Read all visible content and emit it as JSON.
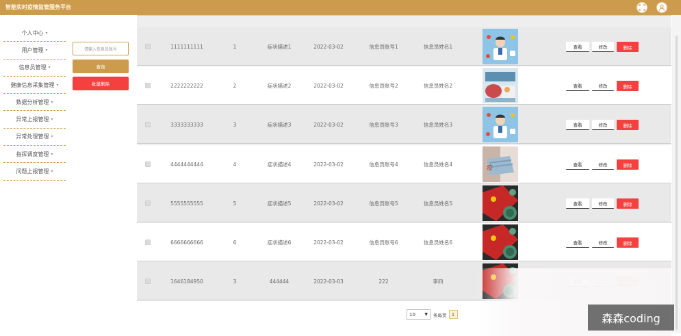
{
  "app": {
    "title": "智能实时疫情监管服务平台"
  },
  "topbar_icons": [
    "fullscreen-icon",
    "user-icon"
  ],
  "sidebar": {
    "items": [
      {
        "label": "个人中心"
      },
      {
        "label": "用户管理"
      },
      {
        "label": "信息员管理"
      },
      {
        "label": "健康信息采集管理"
      },
      {
        "label": "数据分析管理"
      },
      {
        "label": "异常上报管理"
      },
      {
        "label": "异常处理管理"
      },
      {
        "label": "指挥调度管理"
      },
      {
        "label": "问题上报管理"
      }
    ],
    "chevron": "▾"
  },
  "search": {
    "placeholder": "请输入信息员账号",
    "query_label": "查询",
    "batch_delete_label": "批量删除"
  },
  "table": {
    "rows": [
      {
        "account": "1111111111",
        "count": "1",
        "symptom": "症状描述1",
        "date": "2022-03-02",
        "informant_account": "信息员账号1",
        "informant_name": "信息员姓名1",
        "image": "doctor"
      },
      {
        "account": "2222222222",
        "count": "2",
        "symptom": "症状描述2",
        "date": "2022-03-02",
        "informant_account": "信息员账号2",
        "informant_name": "信息员姓名2",
        "image": "lab"
      },
      {
        "account": "3333333333",
        "count": "3",
        "symptom": "症状描述3",
        "date": "2022-03-02",
        "informant_account": "信息员账号3",
        "informant_name": "信息员姓名3",
        "image": "doctor"
      },
      {
        "account": "4444444444",
        "count": "4",
        "symptom": "症状描述4",
        "date": "2022-03-02",
        "informant_account": "信息员账号4",
        "informant_name": "信息员姓名4",
        "image": "mask"
      },
      {
        "account": "5555555555",
        "count": "5",
        "symptom": "症状描述5",
        "date": "2022-03-02",
        "informant_account": "信息员账号5",
        "informant_name": "信息员姓名5",
        "image": "virus"
      },
      {
        "account": "6666666666",
        "count": "6",
        "symptom": "症状描述6",
        "date": "2022-03-02",
        "informant_account": "信息员账号6",
        "informant_name": "信息员姓名6",
        "image": "virus"
      },
      {
        "account": "1646184950",
        "count": "3",
        "symptom": "444444",
        "date": "2022-03-03",
        "informant_account": "222",
        "informant_name": "李四",
        "image": "virus"
      }
    ],
    "actions": {
      "view": "查看",
      "edit": "修改",
      "delete": "删除"
    }
  },
  "pagination": {
    "page_size": "10",
    "goto_label": "条每页",
    "current_page": "1"
  },
  "watermark": "森森coding",
  "colors": {
    "brand": "#cc9c4c",
    "danger": "#f4413f",
    "row_alt": "#e9e9e9"
  }
}
